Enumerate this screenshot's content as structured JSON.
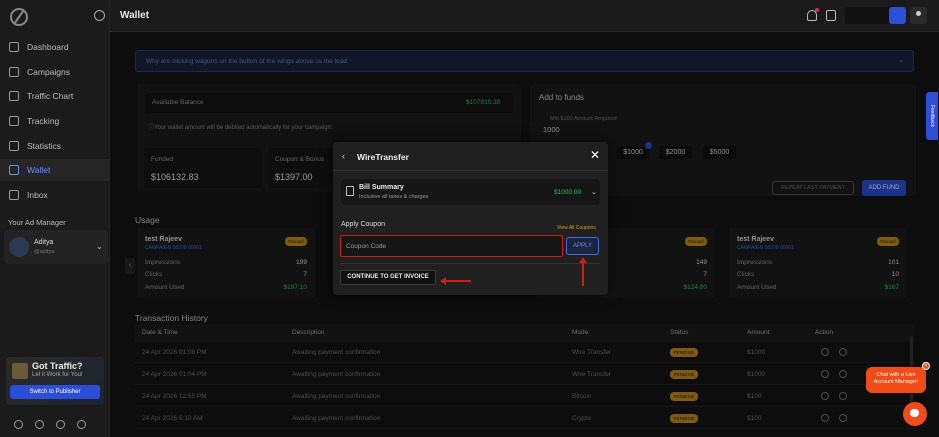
{
  "colors": {
    "accent": "#2d4fd8",
    "success": "#27c16a",
    "pending": "#c8891c",
    "highlight": "#d21b1b",
    "chat": "#f24b1a"
  },
  "sidebar": {
    "items": [
      {
        "label": "Dashboard",
        "icon": "home-icon"
      },
      {
        "label": "Campaigns",
        "icon": "campaign-icon"
      },
      {
        "label": "Traffic Chart",
        "icon": "chart-icon"
      },
      {
        "label": "Tracking",
        "icon": "tracking-icon"
      },
      {
        "label": "Statistics",
        "icon": "statistics-icon"
      },
      {
        "label": "Wallet",
        "icon": "wallet-icon",
        "active": true
      },
      {
        "label": "Inbox",
        "icon": "inbox-icon"
      }
    ],
    "ad_manager_label": "Your Ad Manager",
    "ad_manager_name": "Aditya",
    "ad_manager_sub": "@aditya",
    "promo_title": "Got Traffic?",
    "promo_sub": "Let it Work for You!",
    "promo_button": "Switch to Publisher"
  },
  "header": {
    "title": "Wallet"
  },
  "notice": "Why are clicking wagons on the button of the wings above us the load",
  "balance": {
    "label": "Available Balance",
    "value": "$107815.38",
    "note": "Your wallet amount will be debited automatically for your campaign.",
    "funded_label": "Funded",
    "funded_value": "$106132.83",
    "coupon_label": "Coupon & Bonus",
    "coupon_value": "$1397.00"
  },
  "add_funds": {
    "title": "Add to funds",
    "min_label": "Min $100 Amount Required",
    "amount": "1000",
    "chips": [
      "$1000",
      "$2000",
      "$5000"
    ],
    "repeat_label": "REPEAT LAST PAYMENT",
    "add_label": "ADD FUND"
  },
  "usage": {
    "title": "Usage",
    "cards": [
      {
        "name": "test Rajeev",
        "sub": "CAMPAIGN 00000 00001",
        "badge": "Paused",
        "impressions": "199",
        "clicks": "7",
        "amount": "$197.10"
      },
      {
        "name": "",
        "sub": "",
        "badge": "Paused",
        "impressions": "149",
        "clicks": "7",
        "amount": "$124.00"
      },
      {
        "name": "test Rajeev",
        "sub": "CAMPAIGN 00000 00001",
        "badge": "Paused",
        "impressions": "101",
        "clicks": "10",
        "amount": "$167"
      }
    ],
    "impressions_label": "Impressions",
    "clicks_label": "Clicks",
    "amount_label": "Amount Used"
  },
  "history": {
    "title": "Transaction History",
    "columns": [
      "Date & Time",
      "Description",
      "Mode",
      "Status",
      "Amount",
      "Action"
    ],
    "rows": [
      {
        "date": "24 Apr 2026 01:08 PM",
        "desc": "Awaiting payment confirmation",
        "mode": "Wire Transfer",
        "status": "PENDING",
        "amount": "$1000"
      },
      {
        "date": "24 Apr 2026 01:04 PM",
        "desc": "Awaiting payment confirmation",
        "mode": "Wire Transfer",
        "status": "PENDING",
        "amount": "$1000"
      },
      {
        "date": "24 Apr 2026 12:55 PM",
        "desc": "Awaiting payment confirmation",
        "mode": "Bitcoin",
        "status": "PENDING",
        "amount": "$100"
      },
      {
        "date": "24 Apr 2026 6:10 AM",
        "desc": "Awaiting payment confirmation",
        "mode": "Crypto",
        "status": "PENDING",
        "amount": "$100"
      }
    ]
  },
  "modal": {
    "title": "WireTransfer",
    "bill_title": "Bill Summary",
    "bill_sub": "Inclusive all taxes & charges",
    "bill_amount": "$1000.00",
    "apply_coupon_label": "Apply Coupon",
    "view_all": "View All Coupons",
    "coupon_placeholder": "Coupon Code",
    "apply_label": "APPLY",
    "continue_label": "CONTINUE TO GET INVOICE"
  },
  "feedback_label": "Feedback",
  "chat_label": "Chat with a Live Account Manager!"
}
